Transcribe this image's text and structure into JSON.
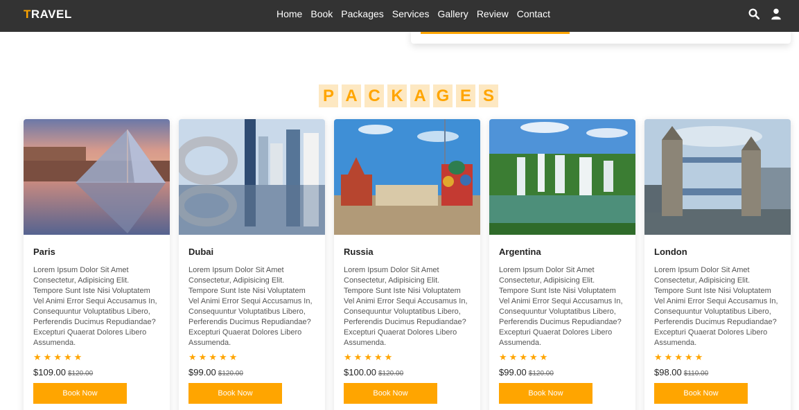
{
  "header": {
    "logo_first": "T",
    "logo_rest": "RAVEL",
    "nav": [
      "Home",
      "Book",
      "Packages",
      "Services",
      "Gallery",
      "Review",
      "Contact"
    ],
    "icons": [
      "search-icon",
      "user-icon"
    ]
  },
  "section": {
    "heading_letters": [
      "P",
      "A",
      "C",
      "K",
      "A",
      "G",
      "E",
      "S"
    ]
  },
  "colors": {
    "accent": "#ffa500",
    "header_bg": "#333333",
    "heading_bg": "#fde8c2"
  },
  "packages": [
    {
      "title": "Paris",
      "description": "Lorem Ipsum Dolor Sit Amet Consectetur, Adipisicing Elit. Tempore Sunt Iste Nisi Voluptatem Vel Animi Error Sequi Accusamus In, Consequuntur Voluptatibus Libero, Perferendis Ducimus Repudiandae? Excepturi Quaerat Dolores Libero Assumenda.",
      "rating": 5,
      "price": "$109.00",
      "old_price": "$120.00",
      "button": "Book Now"
    },
    {
      "title": "Dubai",
      "description": "Lorem Ipsum Dolor Sit Amet Consectetur, Adipisicing Elit. Tempore Sunt Iste Nisi Voluptatem Vel Animi Error Sequi Accusamus In, Consequuntur Voluptatibus Libero, Perferendis Ducimus Repudiandae? Excepturi Quaerat Dolores Libero Assumenda.",
      "rating": 5,
      "price": "$99.00",
      "old_price": "$120.00",
      "button": "Book Now"
    },
    {
      "title": "Russia",
      "description": "Lorem Ipsum Dolor Sit Amet Consectetur, Adipisicing Elit. Tempore Sunt Iste Nisi Voluptatem Vel Animi Error Sequi Accusamus In, Consequuntur Voluptatibus Libero, Perferendis Ducimus Repudiandae? Excepturi Quaerat Dolores Libero Assumenda.",
      "rating": 5,
      "price": "$100.00",
      "old_price": "$120.00",
      "button": "Book Now"
    },
    {
      "title": "Argentina",
      "description": "Lorem Ipsum Dolor Sit Amet Consectetur, Adipisicing Elit. Tempore Sunt Iste Nisi Voluptatem Vel Animi Error Sequi Accusamus In, Consequuntur Voluptatibus Libero, Perferendis Ducimus Repudiandae? Excepturi Quaerat Dolores Libero Assumenda.",
      "rating": 5,
      "price": "$99.00",
      "old_price": "$120.00",
      "button": "Book Now"
    },
    {
      "title": "London",
      "description": "Lorem Ipsum Dolor Sit Amet Consectetur, Adipisicing Elit. Tempore Sunt Iste Nisi Voluptatem Vel Animi Error Sequi Accusamus In, Consequuntur Voluptatibus Libero, Perferendis Ducimus Repudiandae? Excepturi Quaerat Dolores Libero Assumenda.",
      "rating": 5,
      "price": "$98.00",
      "old_price": "$110.00",
      "button": "Book Now"
    }
  ]
}
